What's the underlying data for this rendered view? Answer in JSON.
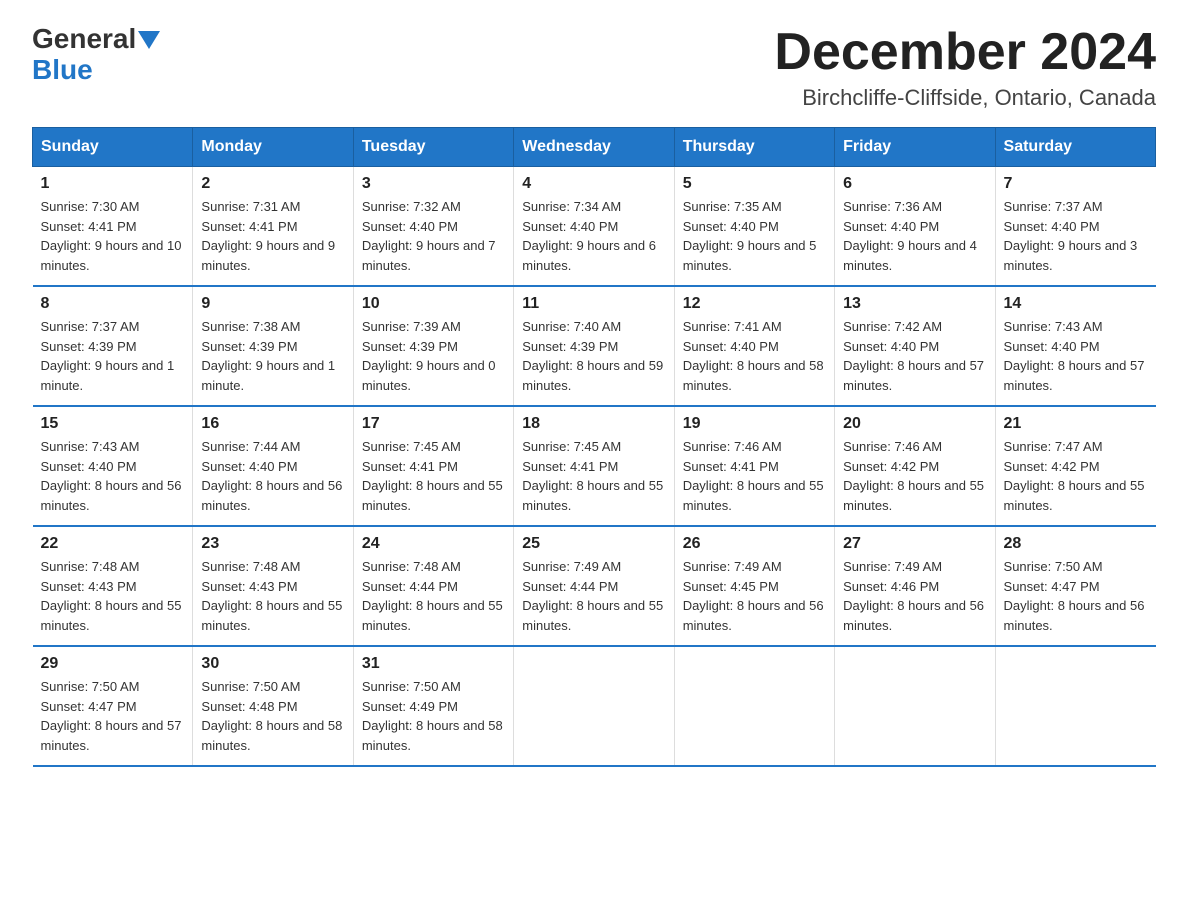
{
  "header": {
    "logo_general": "General",
    "logo_blue": "Blue",
    "month_title": "December 2024",
    "location": "Birchcliffe-Cliffside, Ontario, Canada"
  },
  "days_of_week": [
    "Sunday",
    "Monday",
    "Tuesday",
    "Wednesday",
    "Thursday",
    "Friday",
    "Saturday"
  ],
  "weeks": [
    [
      {
        "day": "1",
        "sunrise": "7:30 AM",
        "sunset": "4:41 PM",
        "daylight": "9 hours and 10 minutes."
      },
      {
        "day": "2",
        "sunrise": "7:31 AM",
        "sunset": "4:41 PM",
        "daylight": "9 hours and 9 minutes."
      },
      {
        "day": "3",
        "sunrise": "7:32 AM",
        "sunset": "4:40 PM",
        "daylight": "9 hours and 7 minutes."
      },
      {
        "day": "4",
        "sunrise": "7:34 AM",
        "sunset": "4:40 PM",
        "daylight": "9 hours and 6 minutes."
      },
      {
        "day": "5",
        "sunrise": "7:35 AM",
        "sunset": "4:40 PM",
        "daylight": "9 hours and 5 minutes."
      },
      {
        "day": "6",
        "sunrise": "7:36 AM",
        "sunset": "4:40 PM",
        "daylight": "9 hours and 4 minutes."
      },
      {
        "day": "7",
        "sunrise": "7:37 AM",
        "sunset": "4:40 PM",
        "daylight": "9 hours and 3 minutes."
      }
    ],
    [
      {
        "day": "8",
        "sunrise": "7:37 AM",
        "sunset": "4:39 PM",
        "daylight": "9 hours and 1 minute."
      },
      {
        "day": "9",
        "sunrise": "7:38 AM",
        "sunset": "4:39 PM",
        "daylight": "9 hours and 1 minute."
      },
      {
        "day": "10",
        "sunrise": "7:39 AM",
        "sunset": "4:39 PM",
        "daylight": "9 hours and 0 minutes."
      },
      {
        "day": "11",
        "sunrise": "7:40 AM",
        "sunset": "4:39 PM",
        "daylight": "8 hours and 59 minutes."
      },
      {
        "day": "12",
        "sunrise": "7:41 AM",
        "sunset": "4:40 PM",
        "daylight": "8 hours and 58 minutes."
      },
      {
        "day": "13",
        "sunrise": "7:42 AM",
        "sunset": "4:40 PM",
        "daylight": "8 hours and 57 minutes."
      },
      {
        "day": "14",
        "sunrise": "7:43 AM",
        "sunset": "4:40 PM",
        "daylight": "8 hours and 57 minutes."
      }
    ],
    [
      {
        "day": "15",
        "sunrise": "7:43 AM",
        "sunset": "4:40 PM",
        "daylight": "8 hours and 56 minutes."
      },
      {
        "day": "16",
        "sunrise": "7:44 AM",
        "sunset": "4:40 PM",
        "daylight": "8 hours and 56 minutes."
      },
      {
        "day": "17",
        "sunrise": "7:45 AM",
        "sunset": "4:41 PM",
        "daylight": "8 hours and 55 minutes."
      },
      {
        "day": "18",
        "sunrise": "7:45 AM",
        "sunset": "4:41 PM",
        "daylight": "8 hours and 55 minutes."
      },
      {
        "day": "19",
        "sunrise": "7:46 AM",
        "sunset": "4:41 PM",
        "daylight": "8 hours and 55 minutes."
      },
      {
        "day": "20",
        "sunrise": "7:46 AM",
        "sunset": "4:42 PM",
        "daylight": "8 hours and 55 minutes."
      },
      {
        "day": "21",
        "sunrise": "7:47 AM",
        "sunset": "4:42 PM",
        "daylight": "8 hours and 55 minutes."
      }
    ],
    [
      {
        "day": "22",
        "sunrise": "7:48 AM",
        "sunset": "4:43 PM",
        "daylight": "8 hours and 55 minutes."
      },
      {
        "day": "23",
        "sunrise": "7:48 AM",
        "sunset": "4:43 PM",
        "daylight": "8 hours and 55 minutes."
      },
      {
        "day": "24",
        "sunrise": "7:48 AM",
        "sunset": "4:44 PM",
        "daylight": "8 hours and 55 minutes."
      },
      {
        "day": "25",
        "sunrise": "7:49 AM",
        "sunset": "4:44 PM",
        "daylight": "8 hours and 55 minutes."
      },
      {
        "day": "26",
        "sunrise": "7:49 AM",
        "sunset": "4:45 PM",
        "daylight": "8 hours and 56 minutes."
      },
      {
        "day": "27",
        "sunrise": "7:49 AM",
        "sunset": "4:46 PM",
        "daylight": "8 hours and 56 minutes."
      },
      {
        "day": "28",
        "sunrise": "7:50 AM",
        "sunset": "4:47 PM",
        "daylight": "8 hours and 56 minutes."
      }
    ],
    [
      {
        "day": "29",
        "sunrise": "7:50 AM",
        "sunset": "4:47 PM",
        "daylight": "8 hours and 57 minutes."
      },
      {
        "day": "30",
        "sunrise": "7:50 AM",
        "sunset": "4:48 PM",
        "daylight": "8 hours and 58 minutes."
      },
      {
        "day": "31",
        "sunrise": "7:50 AM",
        "sunset": "4:49 PM",
        "daylight": "8 hours and 58 minutes."
      },
      null,
      null,
      null,
      null
    ]
  ],
  "labels": {
    "sunrise": "Sunrise:",
    "sunset": "Sunset:",
    "daylight": "Daylight:"
  },
  "colors": {
    "header_bg": "#2176c7",
    "header_text": "#ffffff",
    "border": "#2176c7"
  }
}
